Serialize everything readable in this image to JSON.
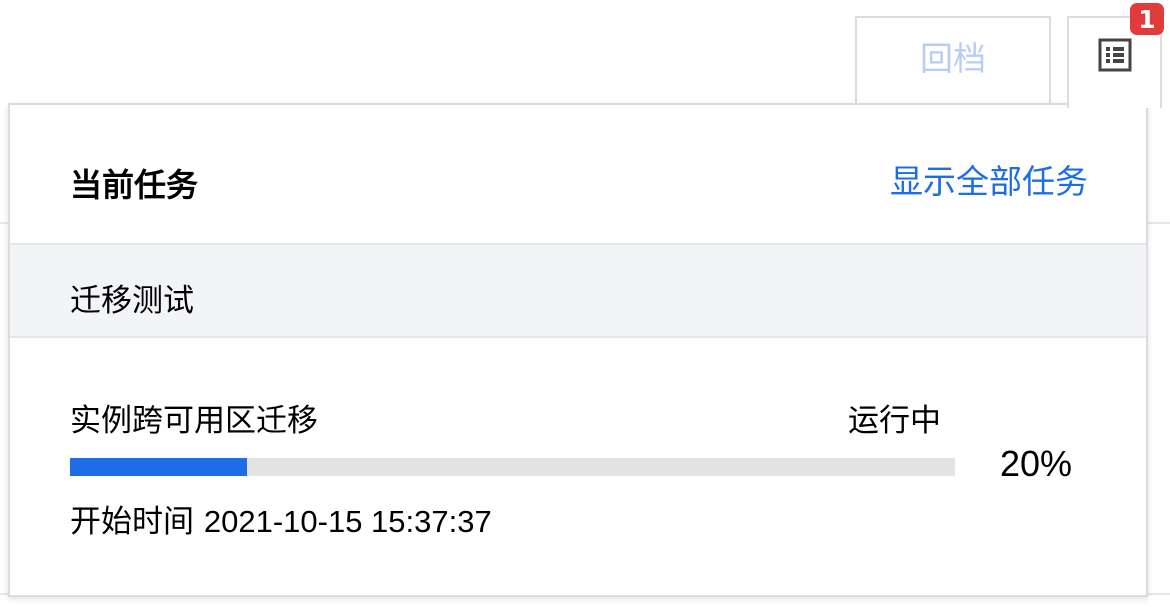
{
  "toolbar": {
    "rollback_label": "回档",
    "tasks_icon": "task-list-icon",
    "tasks_badge_count": "1"
  },
  "panel": {
    "title": "当前任务",
    "show_all_label": "显示全部任务",
    "group": {
      "label": "迁移测试"
    },
    "task": {
      "name": "实例跨可用区迁移",
      "status": "运行中",
      "progress_percent_text": "20%",
      "progress_fraction": 0.2,
      "start_time_label": "开始时间",
      "start_time_value": "2021-10-15 15:37:37"
    }
  },
  "colors": {
    "accent": "#1c6de6",
    "badge": "#e23b3b",
    "rollback_text": "#b7cdf6",
    "group_bg": "#f2f4f8",
    "track": "#e3e3e3"
  }
}
